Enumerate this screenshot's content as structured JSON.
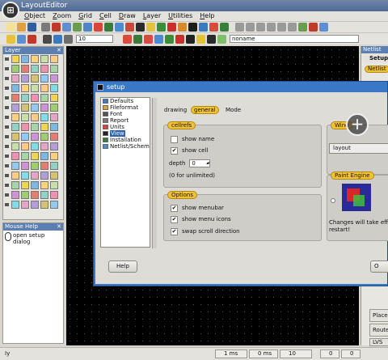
{
  "window": {
    "title": "LayoutEditor"
  },
  "menubar": [
    "Object",
    "Zoom",
    "Grid",
    "Cell",
    "Draw",
    "Layer",
    "Utilities",
    "Help"
  ],
  "toolbar": {
    "number_value": "10",
    "cellname_value": "noname"
  },
  "layer_panel": {
    "title": "Layer"
  },
  "mouse_help": {
    "title": "Mouse Help",
    "text": "open setup dialog"
  },
  "netlist_panel": {
    "title": "Netlist",
    "tab1": "Setup",
    "tab2": "Netlist",
    "place": "Place",
    "route": "Route",
    "lvs": "LVS"
  },
  "statusbar": {
    "left": "Iy",
    "time1": "1 ms",
    "time2": "0 ms",
    "count": "10",
    "f1": "0",
    "f2": "0"
  },
  "dialog": {
    "title": "setup",
    "tree": [
      {
        "label": "Defaults",
        "selected": false
      },
      {
        "label": "Fileformat",
        "selected": false
      },
      {
        "label": "Font",
        "selected": false
      },
      {
        "label": "Report",
        "selected": false
      },
      {
        "label": "Units",
        "selected": false
      },
      {
        "label": "View",
        "selected": true
      },
      {
        "label": "Installation",
        "selected": false
      },
      {
        "label": "Netlist/Schem",
        "selected": false
      }
    ],
    "tabs": {
      "drawing": "drawing",
      "general": "general",
      "mode": "Mode"
    },
    "cellrefs": {
      "title": "cellrefs",
      "show_name": "show name",
      "show_cell": "show cell",
      "depth_label": "depth",
      "depth_value": "0",
      "unlimited_note": "(0 for unlimited)"
    },
    "options": {
      "title": "Options",
      "show_menubar": "show menubar",
      "show_menu_icons": "show menu icons",
      "swap_scroll": "swap scroll direction"
    },
    "window_group": {
      "title": "Wind",
      "layout_value": "layout"
    },
    "paint_engine": {
      "title": "Paint Engine",
      "note_line1": "Changes will take effe",
      "note_line2": "restart!"
    },
    "help_button": "Help",
    "ok_button": "O"
  }
}
